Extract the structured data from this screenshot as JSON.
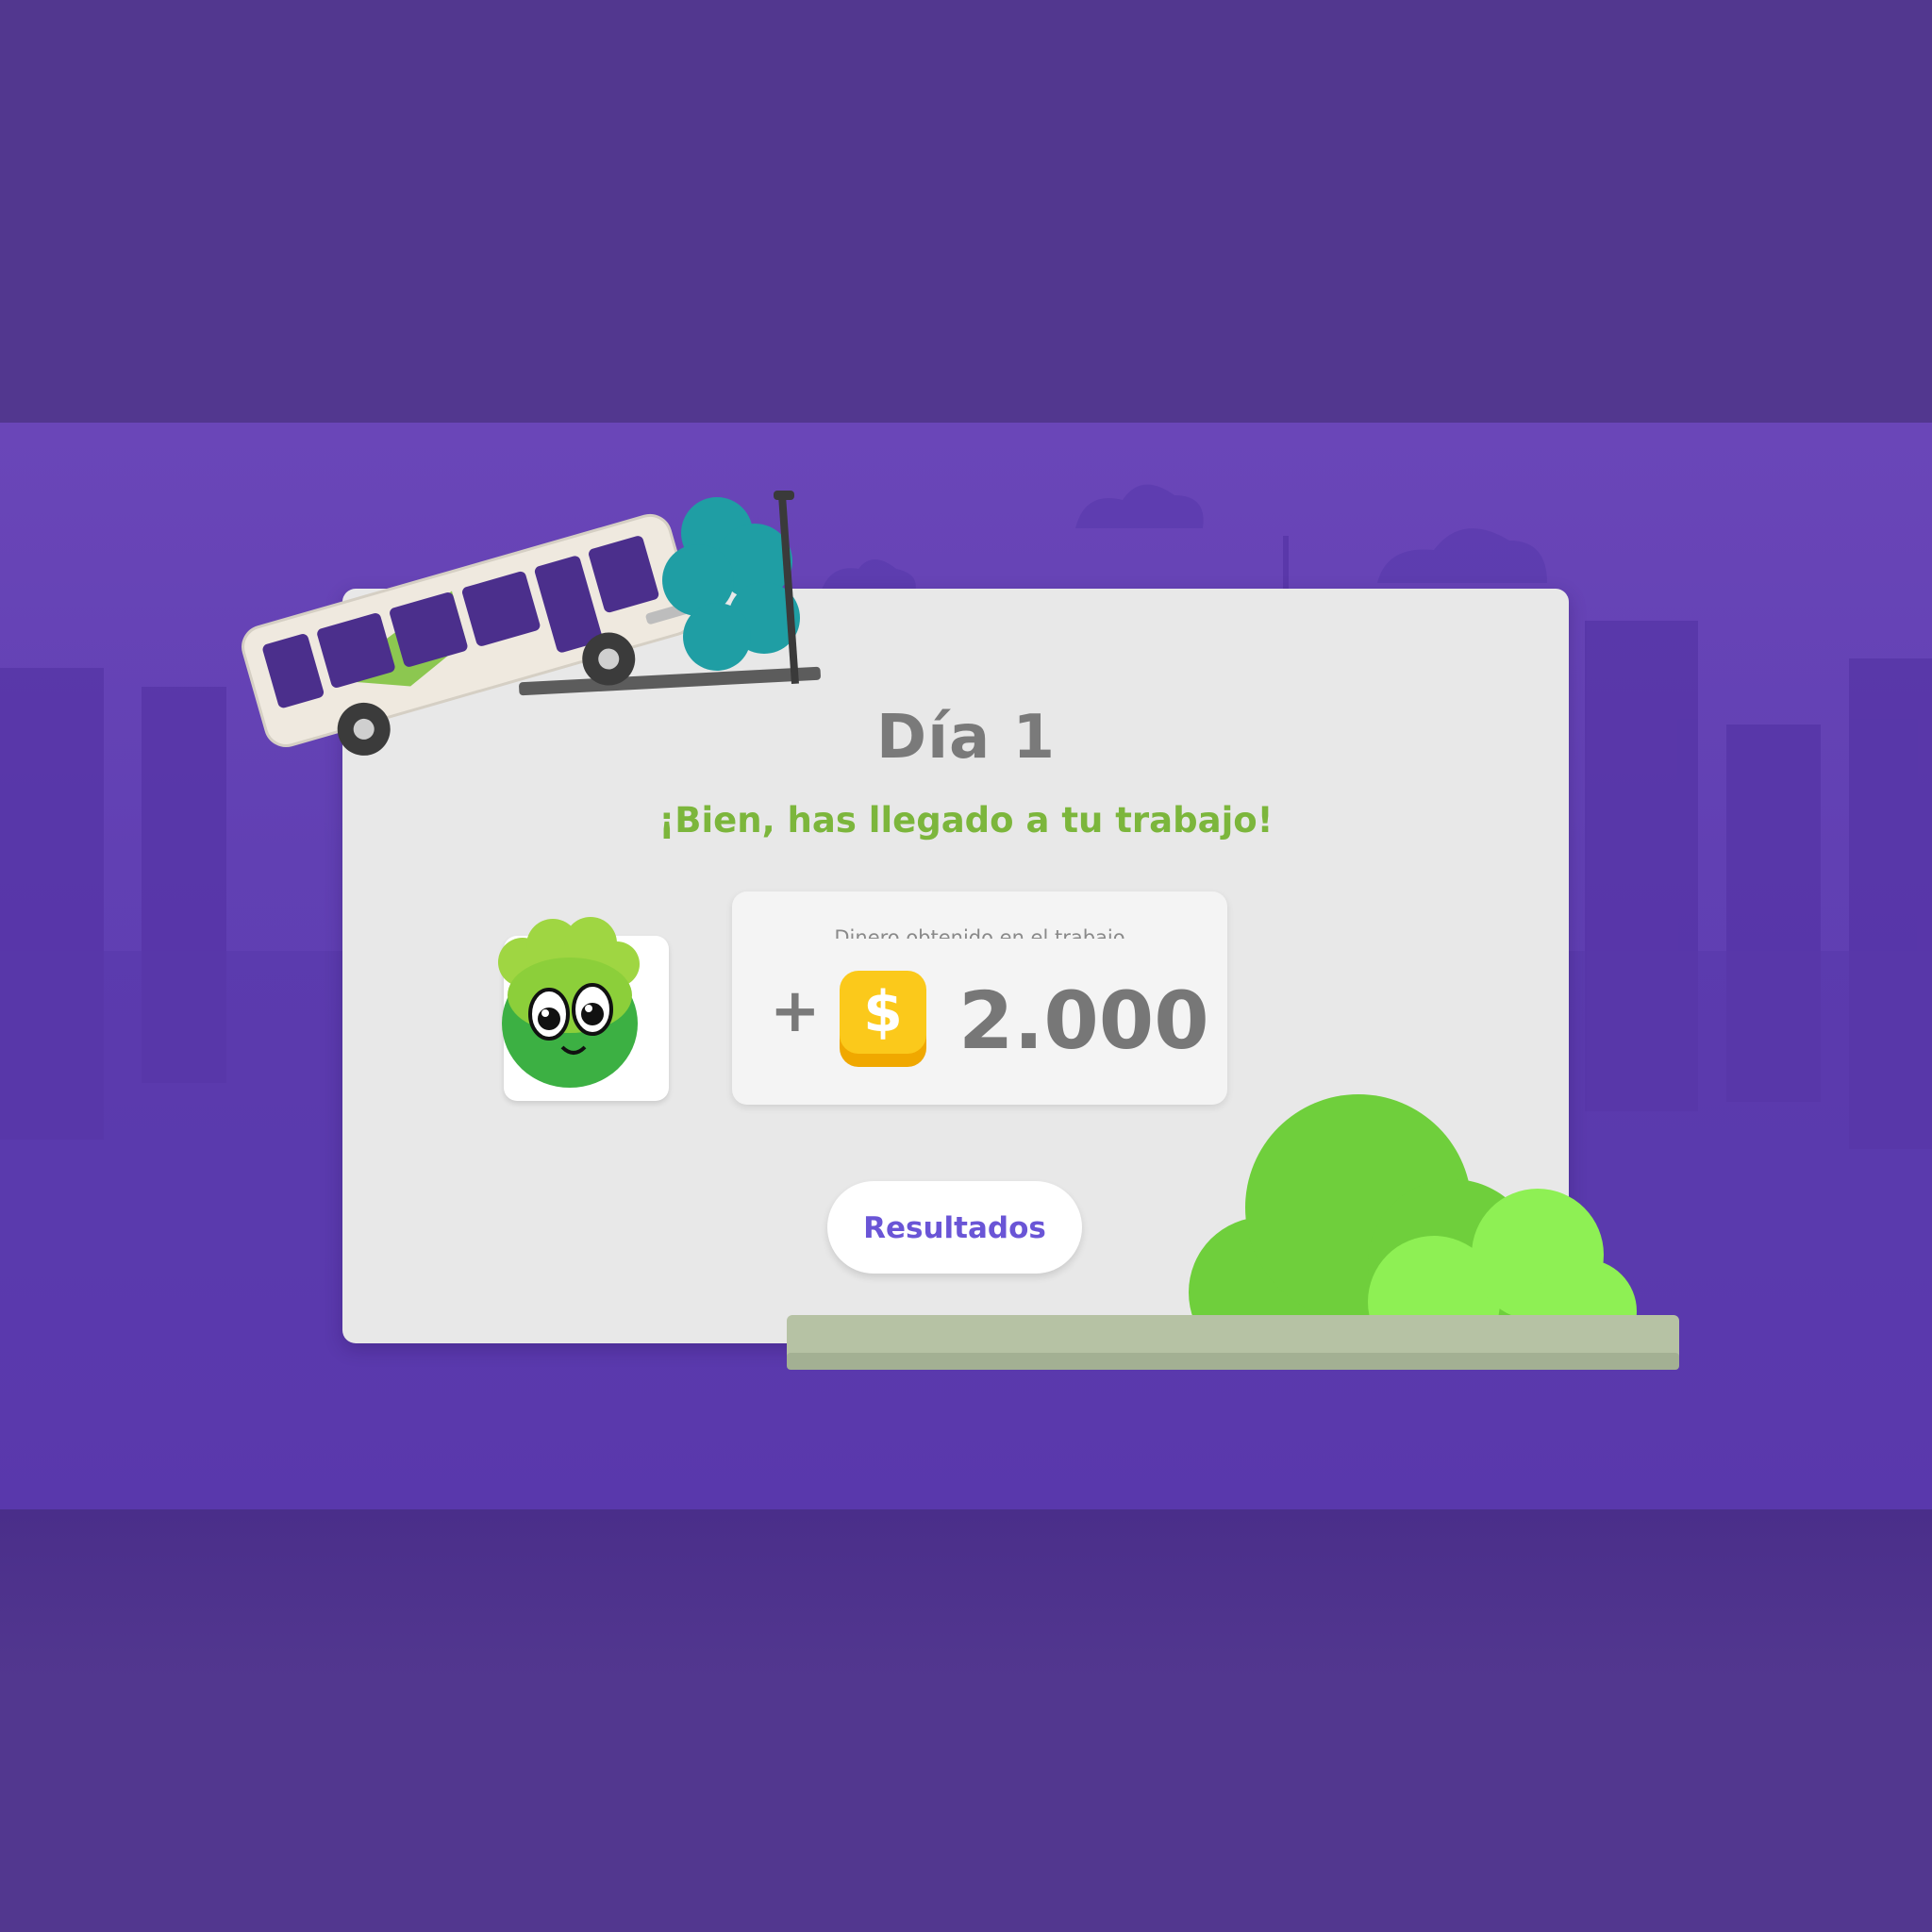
{
  "screen": {
    "title": "Día 1",
    "subtitle": "¡Bien, has llegado a tu trabajo!",
    "money_caption": "Dinero obtenido en el trabajo",
    "plus_sign": "+",
    "currency_symbol": "$",
    "amount": "2.000",
    "results_button": "Resultados"
  },
  "icons": {
    "bus": "bus-illustration",
    "character": "green-blob-character-icon",
    "coin": "dollar-coin-icon",
    "bush": "bush-illustration"
  },
  "colors": {
    "background": "#52378f",
    "scene": "#6140b3",
    "card": "#e8e8e8",
    "title": "#7a7a7a",
    "subtitle": "#7cb63c",
    "button_text": "#6a55d6",
    "coin": "#f9c20c"
  }
}
